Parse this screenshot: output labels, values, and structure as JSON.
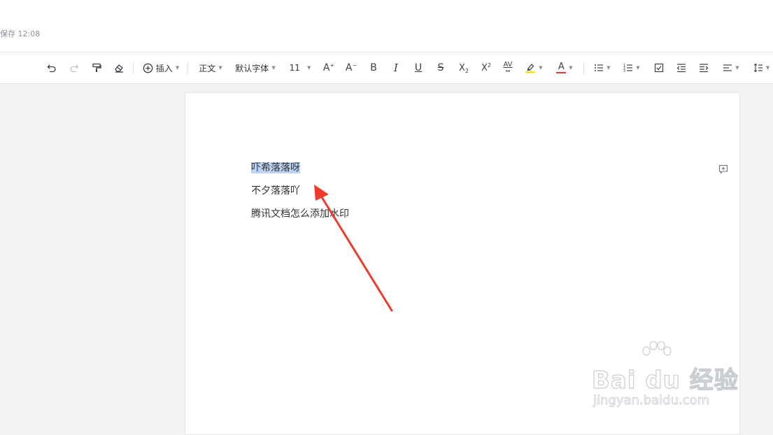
{
  "header": {
    "save_status": "保存 12:08"
  },
  "toolbar": {
    "undo_icon": "undo-icon",
    "redo_icon": "redo-icon",
    "format_painter_icon": "format-painter-icon",
    "clear_format_icon": "eraser-icon",
    "insert_label": "插入",
    "style_label": "正文",
    "font_label": "默认字体",
    "size_label": "11",
    "increase_font": "A",
    "decrease_font": "A",
    "bold": "B",
    "italic": "I",
    "underline": "U",
    "strikethrough": "S",
    "subscript": "X",
    "subscript_mark": "2",
    "superscript": "X",
    "superscript_mark": "2",
    "char_spacing": "AV",
    "font_color_label": "A",
    "highlight_color": "#f5e300",
    "font_color": "#e53935"
  },
  "document": {
    "paragraphs": [
      {
        "text": "吓希落落呀",
        "selected": true
      },
      {
        "text": "不夕落落吖",
        "selected": false
      },
      {
        "text": "腾讯文档怎么添加水印",
        "selected": false
      }
    ]
  },
  "annotation": {
    "arrow_color": "#f03a2e"
  },
  "watermark": {
    "brand": "Bai du 经验",
    "url": "jingyan.baidu.com"
  }
}
